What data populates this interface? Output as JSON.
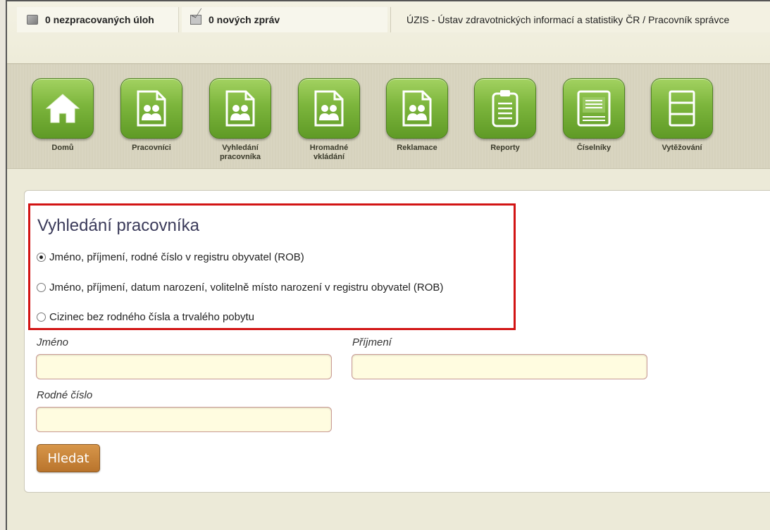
{
  "topbar": {
    "tasks_label": "0 nezpracovaných úloh",
    "messages_label": "0 nových zpráv",
    "org_title": "ÚZIS - Ústav zdravotnických informací a statistiky ČR / Pracovník správce"
  },
  "menu": {
    "items": [
      {
        "label": "Domů",
        "icon": "home-icon"
      },
      {
        "label": "Pracovníci",
        "icon": "people-document-icon"
      },
      {
        "label": "Vyhledání pracovníka",
        "icon": "people-document-icon"
      },
      {
        "label": "Hromadné vkládání",
        "icon": "people-document-icon"
      },
      {
        "label": "Reklamace",
        "icon": "people-document-icon"
      },
      {
        "label": "Reporty",
        "icon": "clipboard-icon"
      },
      {
        "label": "Číselníky",
        "icon": "number-list-icon"
      },
      {
        "label": "Vytěžování",
        "icon": "sections-document-icon"
      }
    ],
    "accent_color": "#7cb53c"
  },
  "search": {
    "title": "Vyhledání pracovníka",
    "options": [
      {
        "label": "Jméno, příjmení, rodné číslo v registru obyvatel (ROB)",
        "checked": true
      },
      {
        "label": "Jméno, příjmení, datum narození, volitelně místo narození v registru obyvatel (ROB)",
        "checked": false
      },
      {
        "label": "Cizinec bez rodného čísla a trvalého pobytu",
        "checked": false
      }
    ],
    "fields": {
      "first_name_label": "Jméno",
      "first_name_value": "",
      "last_name_label": "Příjmení",
      "last_name_value": "",
      "birth_number_label": "Rodné číslo",
      "birth_number_value": ""
    },
    "submit_label": "Hledat",
    "highlight_color": "#d21414"
  }
}
